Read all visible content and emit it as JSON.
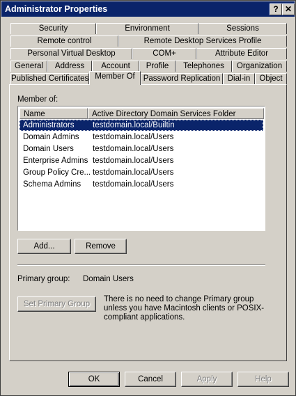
{
  "window": {
    "title": "Administrator Properties",
    "help_btn": "?",
    "close_btn": "✕"
  },
  "tabs": {
    "row1": [
      "Security",
      "Environment",
      "Sessions"
    ],
    "row2": [
      "Remote control",
      "Remote Desktop Services Profile"
    ],
    "row3": [
      "Personal Virtual Desktop",
      "COM+",
      "Attribute Editor"
    ],
    "row4": [
      "General",
      "Address",
      "Account",
      "Profile",
      "Telephones",
      "Organization"
    ],
    "row5": [
      "Published Certificates",
      "Member Of",
      "Password Replication",
      "Dial-in",
      "Object"
    ],
    "selected": "Member Of"
  },
  "member_of": {
    "label": "Member of:",
    "columns": [
      "Name",
      "Active Directory Domain Services Folder"
    ],
    "rows": [
      {
        "name": "Administrators",
        "folder": "testdomain.local/Builtin",
        "selected": true
      },
      {
        "name": "Domain Admins",
        "folder": "testdomain.local/Users"
      },
      {
        "name": "Domain Users",
        "folder": "testdomain.local/Users"
      },
      {
        "name": "Enterprise Admins",
        "folder": "testdomain.local/Users"
      },
      {
        "name": "Group Policy Cre...",
        "folder": "testdomain.local/Users"
      },
      {
        "name": "Schema Admins",
        "folder": "testdomain.local/Users"
      }
    ]
  },
  "buttons": {
    "add": "Add...",
    "remove": "Remove",
    "set_primary": "Set Primary Group",
    "ok": "OK",
    "cancel": "Cancel",
    "apply": "Apply",
    "help": "Help"
  },
  "primary_group": {
    "label": "Primary group:",
    "value": "Domain Users",
    "note": "There is no need to change Primary group unless you have Macintosh clients or POSIX-compliant applications."
  }
}
